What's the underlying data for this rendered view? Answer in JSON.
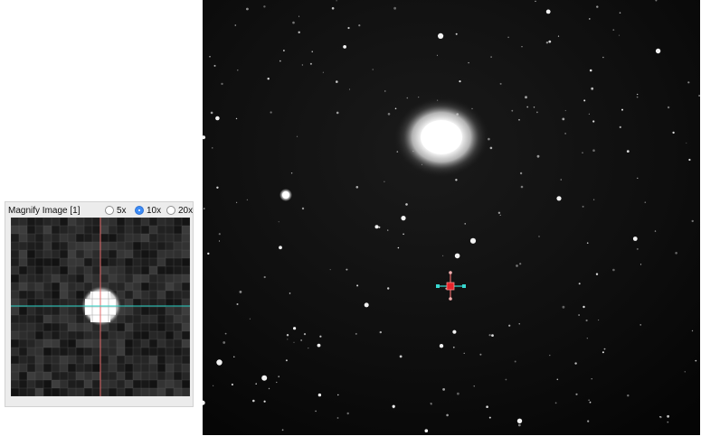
{
  "magnify": {
    "title": "Magnify Image [1]",
    "zoom_options": [
      {
        "label": "5x",
        "selected": false
      },
      {
        "label": "10x",
        "selected": true
      },
      {
        "label": "20x",
        "selected": false
      }
    ]
  },
  "colors": {
    "panel_bg": "#ececec",
    "crosshair_vertical": "#e36a6a",
    "crosshair_horizontal": "#2bd3c6",
    "marker_red": "#e8242b",
    "marker_cyan": "#38d8d0",
    "radio_selected": "#3d8cf6"
  }
}
